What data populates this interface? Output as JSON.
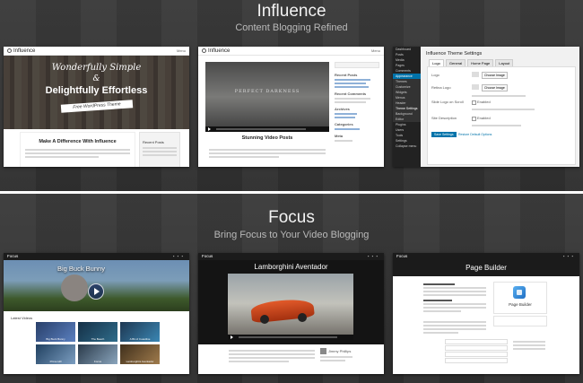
{
  "influence": {
    "title": "Influence",
    "subtitle": "Content Blogging Refined",
    "shot1": {
      "logo": "Influence",
      "menu": "Menu",
      "hero_line1": "Wonderfully Simple",
      "hero_amp": "&",
      "hero_line2": "Delightfully Effortless",
      "ribbon": "Free WordPress Theme",
      "heading": "Make A Difference With Influence",
      "sidebar_title": "Recent Posts"
    },
    "shot2": {
      "logo": "Influence",
      "menu": "Menu",
      "video_title": "Perfect Darkness",
      "heading": "Stunning Video Posts",
      "sidebar": [
        "Recent Posts",
        "Recent Comments",
        "Archives",
        "Categories",
        "Meta"
      ]
    },
    "shot3": {
      "page_title": "Influence Theme Settings",
      "tabs": [
        "Logo",
        "General",
        "Home Page",
        "Layout"
      ],
      "fields": [
        "Logo",
        "Retina Logo",
        "Slide Logo on Scroll",
        "Site Description"
      ],
      "choose_button": "Choose Image",
      "enabled_label": "Enabled",
      "save_button": "Save Settings",
      "reset_button": "Restore Default Options",
      "menu": [
        "Dashboard",
        "Posts",
        "Media",
        "Pages",
        "Comments",
        "Appearance",
        "Themes",
        "Customize",
        "Widgets",
        "Menus",
        "Header",
        "Theme Settings",
        "Background",
        "Editor",
        "Plugins",
        "Users",
        "Tools",
        "Settings",
        "Collapse menu"
      ]
    }
  },
  "focus": {
    "title": "Focus",
    "subtitle": "Bring Focus to Your Video Blogging",
    "shot1": {
      "logo": "Focus",
      "video_title": "Big Buck Bunny",
      "section_label": "Latest Videos",
      "thumbs": [
        "Big Buck Bunny",
        "The Beach",
        "A Bit of Coastline",
        "Prime Hill",
        "Focus",
        "Lamborghini Aventador"
      ]
    },
    "shot2": {
      "logo": "Focus",
      "video_title": "Lamborghini Aventador",
      "author": "Jimmy Phillips"
    },
    "shot3": {
      "logo": "Focus",
      "page_title": "Page Builder",
      "feature_label": "Page Builder"
    }
  },
  "colors": {
    "band": "#333333",
    "wp_accent": "#0073aa",
    "focus_blue": "#2b7fd0"
  }
}
